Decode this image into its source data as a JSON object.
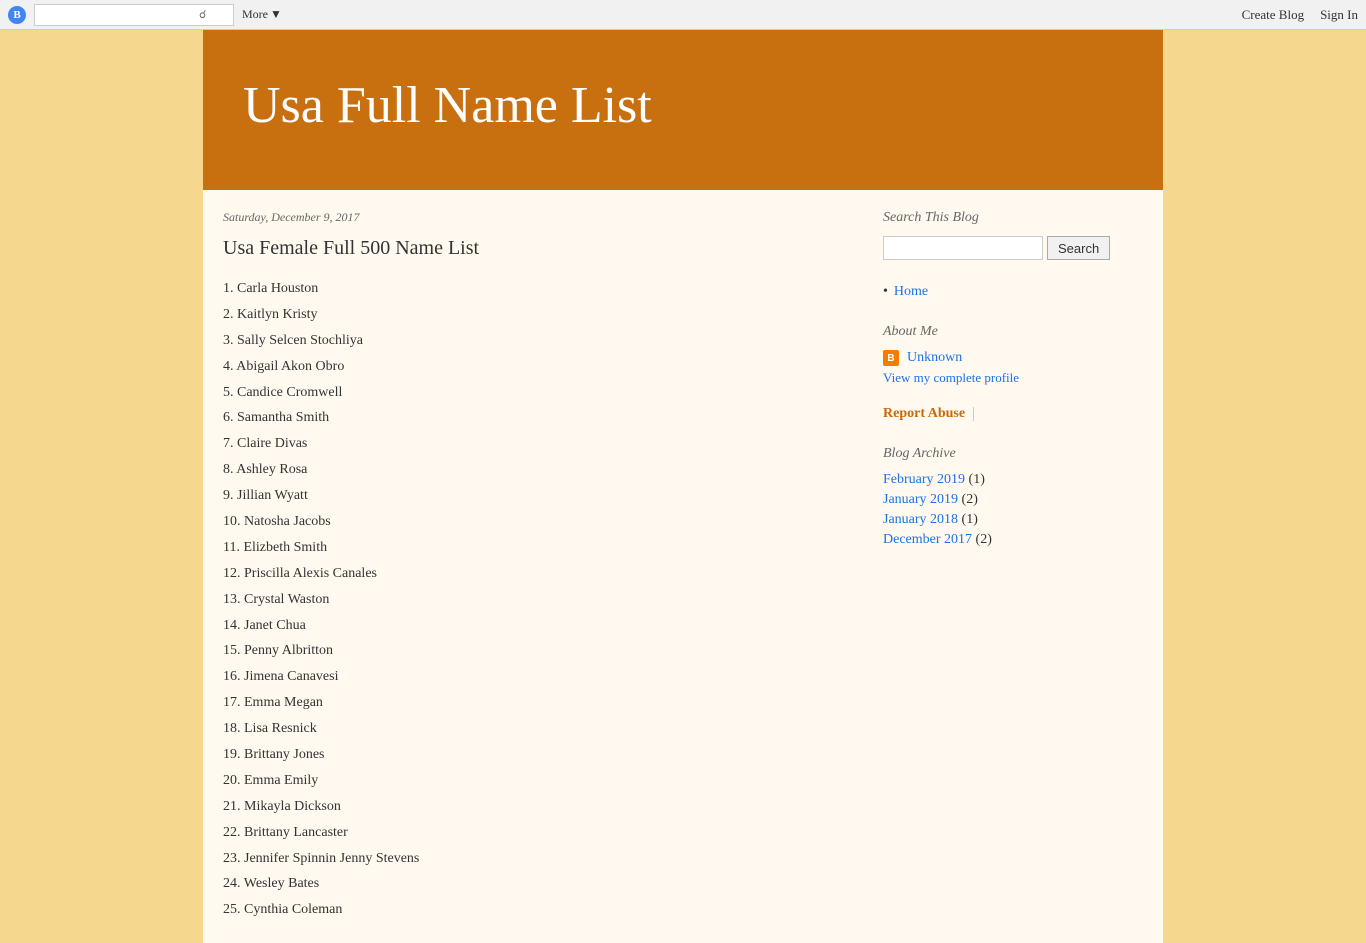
{
  "navbar": {
    "logo_text": "B",
    "search_placeholder": "",
    "more_label": "More",
    "create_blog_label": "Create Blog",
    "sign_in_label": "Sign In"
  },
  "blog": {
    "title": "Usa Full Name List",
    "header_bg": "#c8700f"
  },
  "post": {
    "date": "Saturday, December 9, 2017",
    "title": "Usa Female Full 500 Name List",
    "names": [
      "1. Carla Houston",
      "2. Kaitlyn Kristy",
      "3. Sally Selcen Stochliya",
      "4. Abigail Akon Obro",
      "5. Candice Cromwell",
      "6. Samantha Smith",
      "7. Claire Divas",
      "8. Ashley Rosa",
      "9. Jillian Wyatt",
      "10. Natosha Jacobs",
      "11. Elizbeth Smith",
      "12. Priscilla Alexis Canales",
      "13. Crystal Waston",
      "14. Janet Chua",
      "15. Penny Albritton",
      "16. Jimena Canavesi",
      "17. Emma Megan",
      "18. Lisa Resnick",
      "19. Brittany Jones",
      "20. Emma Emily",
      "21. Mikayla Dickson",
      "22. Brittany Lancaster",
      "23. Jennifer Spinnin Jenny Stevens",
      "24. Wesley Bates",
      "25. Cynthia Coleman"
    ]
  },
  "sidebar": {
    "search_heading": "Search This Blog",
    "search_button": "Search",
    "search_placeholder": "",
    "nav_heading": "",
    "nav_items": [
      {
        "label": "Home",
        "href": "#"
      }
    ],
    "about_heading": "About Me",
    "unknown_label": "Unknown",
    "profile_link_label": "View my complete profile",
    "report_abuse_label": "Report Abuse",
    "archive_heading": "Blog Archive",
    "archive_items": [
      {
        "label": "February 2019",
        "count": "(1)"
      },
      {
        "label": "January 2019",
        "count": "(2)"
      },
      {
        "label": "January 2018",
        "count": "(1)"
      },
      {
        "label": "December 2017",
        "count": "(2)"
      }
    ]
  }
}
